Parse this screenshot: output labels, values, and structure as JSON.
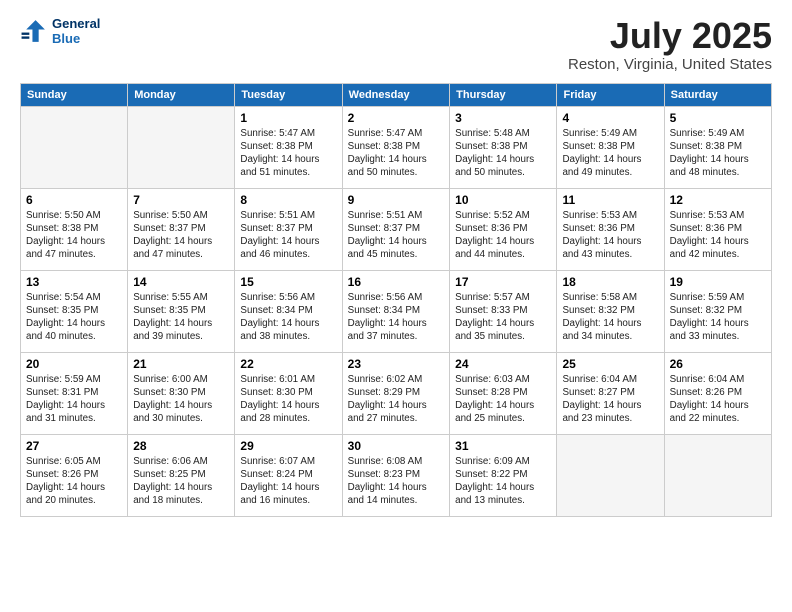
{
  "header": {
    "logo_line1": "General",
    "logo_line2": "Blue",
    "month": "July 2025",
    "location": "Reston, Virginia, United States"
  },
  "days_of_week": [
    "Sunday",
    "Monday",
    "Tuesday",
    "Wednesday",
    "Thursday",
    "Friday",
    "Saturday"
  ],
  "weeks": [
    [
      {
        "num": "",
        "empty": true
      },
      {
        "num": "",
        "empty": true
      },
      {
        "num": "1",
        "sunrise": "Sunrise: 5:47 AM",
        "sunset": "Sunset: 8:38 PM",
        "daylight": "Daylight: 14 hours and 51 minutes."
      },
      {
        "num": "2",
        "sunrise": "Sunrise: 5:47 AM",
        "sunset": "Sunset: 8:38 PM",
        "daylight": "Daylight: 14 hours and 50 minutes."
      },
      {
        "num": "3",
        "sunrise": "Sunrise: 5:48 AM",
        "sunset": "Sunset: 8:38 PM",
        "daylight": "Daylight: 14 hours and 50 minutes."
      },
      {
        "num": "4",
        "sunrise": "Sunrise: 5:49 AM",
        "sunset": "Sunset: 8:38 PM",
        "daylight": "Daylight: 14 hours and 49 minutes."
      },
      {
        "num": "5",
        "sunrise": "Sunrise: 5:49 AM",
        "sunset": "Sunset: 8:38 PM",
        "daylight": "Daylight: 14 hours and 48 minutes."
      }
    ],
    [
      {
        "num": "6",
        "sunrise": "Sunrise: 5:50 AM",
        "sunset": "Sunset: 8:38 PM",
        "daylight": "Daylight: 14 hours and 47 minutes."
      },
      {
        "num": "7",
        "sunrise": "Sunrise: 5:50 AM",
        "sunset": "Sunset: 8:37 PM",
        "daylight": "Daylight: 14 hours and 47 minutes."
      },
      {
        "num": "8",
        "sunrise": "Sunrise: 5:51 AM",
        "sunset": "Sunset: 8:37 PM",
        "daylight": "Daylight: 14 hours and 46 minutes."
      },
      {
        "num": "9",
        "sunrise": "Sunrise: 5:51 AM",
        "sunset": "Sunset: 8:37 PM",
        "daylight": "Daylight: 14 hours and 45 minutes."
      },
      {
        "num": "10",
        "sunrise": "Sunrise: 5:52 AM",
        "sunset": "Sunset: 8:36 PM",
        "daylight": "Daylight: 14 hours and 44 minutes."
      },
      {
        "num": "11",
        "sunrise": "Sunrise: 5:53 AM",
        "sunset": "Sunset: 8:36 PM",
        "daylight": "Daylight: 14 hours and 43 minutes."
      },
      {
        "num": "12",
        "sunrise": "Sunrise: 5:53 AM",
        "sunset": "Sunset: 8:36 PM",
        "daylight": "Daylight: 14 hours and 42 minutes."
      }
    ],
    [
      {
        "num": "13",
        "sunrise": "Sunrise: 5:54 AM",
        "sunset": "Sunset: 8:35 PM",
        "daylight": "Daylight: 14 hours and 40 minutes."
      },
      {
        "num": "14",
        "sunrise": "Sunrise: 5:55 AM",
        "sunset": "Sunset: 8:35 PM",
        "daylight": "Daylight: 14 hours and 39 minutes."
      },
      {
        "num": "15",
        "sunrise": "Sunrise: 5:56 AM",
        "sunset": "Sunset: 8:34 PM",
        "daylight": "Daylight: 14 hours and 38 minutes."
      },
      {
        "num": "16",
        "sunrise": "Sunrise: 5:56 AM",
        "sunset": "Sunset: 8:34 PM",
        "daylight": "Daylight: 14 hours and 37 minutes."
      },
      {
        "num": "17",
        "sunrise": "Sunrise: 5:57 AM",
        "sunset": "Sunset: 8:33 PM",
        "daylight": "Daylight: 14 hours and 35 minutes."
      },
      {
        "num": "18",
        "sunrise": "Sunrise: 5:58 AM",
        "sunset": "Sunset: 8:32 PM",
        "daylight": "Daylight: 14 hours and 34 minutes."
      },
      {
        "num": "19",
        "sunrise": "Sunrise: 5:59 AM",
        "sunset": "Sunset: 8:32 PM",
        "daylight": "Daylight: 14 hours and 33 minutes."
      }
    ],
    [
      {
        "num": "20",
        "sunrise": "Sunrise: 5:59 AM",
        "sunset": "Sunset: 8:31 PM",
        "daylight": "Daylight: 14 hours and 31 minutes."
      },
      {
        "num": "21",
        "sunrise": "Sunrise: 6:00 AM",
        "sunset": "Sunset: 8:30 PM",
        "daylight": "Daylight: 14 hours and 30 minutes."
      },
      {
        "num": "22",
        "sunrise": "Sunrise: 6:01 AM",
        "sunset": "Sunset: 8:30 PM",
        "daylight": "Daylight: 14 hours and 28 minutes."
      },
      {
        "num": "23",
        "sunrise": "Sunrise: 6:02 AM",
        "sunset": "Sunset: 8:29 PM",
        "daylight": "Daylight: 14 hours and 27 minutes."
      },
      {
        "num": "24",
        "sunrise": "Sunrise: 6:03 AM",
        "sunset": "Sunset: 8:28 PM",
        "daylight": "Daylight: 14 hours and 25 minutes."
      },
      {
        "num": "25",
        "sunrise": "Sunrise: 6:04 AM",
        "sunset": "Sunset: 8:27 PM",
        "daylight": "Daylight: 14 hours and 23 minutes."
      },
      {
        "num": "26",
        "sunrise": "Sunrise: 6:04 AM",
        "sunset": "Sunset: 8:26 PM",
        "daylight": "Daylight: 14 hours and 22 minutes."
      }
    ],
    [
      {
        "num": "27",
        "sunrise": "Sunrise: 6:05 AM",
        "sunset": "Sunset: 8:26 PM",
        "daylight": "Daylight: 14 hours and 20 minutes."
      },
      {
        "num": "28",
        "sunrise": "Sunrise: 6:06 AM",
        "sunset": "Sunset: 8:25 PM",
        "daylight": "Daylight: 14 hours and 18 minutes."
      },
      {
        "num": "29",
        "sunrise": "Sunrise: 6:07 AM",
        "sunset": "Sunset: 8:24 PM",
        "daylight": "Daylight: 14 hours and 16 minutes."
      },
      {
        "num": "30",
        "sunrise": "Sunrise: 6:08 AM",
        "sunset": "Sunset: 8:23 PM",
        "daylight": "Daylight: 14 hours and 14 minutes."
      },
      {
        "num": "31",
        "sunrise": "Sunrise: 6:09 AM",
        "sunset": "Sunset: 8:22 PM",
        "daylight": "Daylight: 14 hours and 13 minutes."
      },
      {
        "num": "",
        "empty": true
      },
      {
        "num": "",
        "empty": true
      }
    ]
  ]
}
